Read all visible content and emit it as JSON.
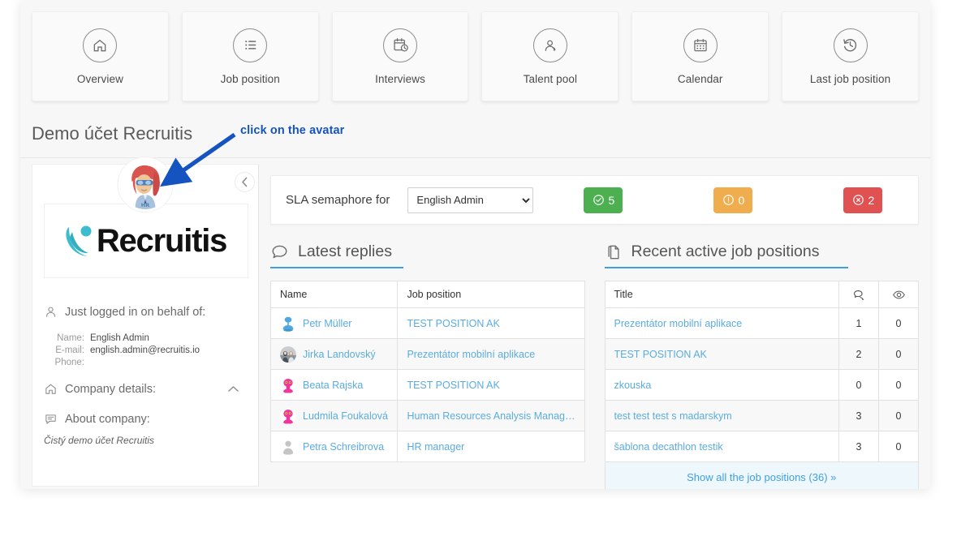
{
  "nav_tiles": [
    {
      "label": "Overview",
      "icon": "home-icon"
    },
    {
      "label": "Job position",
      "icon": "list-icon"
    },
    {
      "label": "Interviews",
      "icon": "calendar-clock-icon"
    },
    {
      "label": "Talent pool",
      "icon": "user-badge-icon"
    },
    {
      "label": "Calendar",
      "icon": "calendar-icon"
    },
    {
      "label": "Last job position",
      "icon": "history-icon"
    }
  ],
  "page_title": "Demo účet Recruitis",
  "annotation": {
    "text": "click on the avatar",
    "color": "#1554c0"
  },
  "sidebar": {
    "collapse_label": "‹",
    "logo_text": "Recruitis",
    "logged_in_heading": "Just logged in on behalf of:",
    "details": [
      {
        "key": "Name:",
        "value": "English Admin"
      },
      {
        "key": "E-mail:",
        "value": "english.admin@recruitis.io"
      },
      {
        "key": "Phone:",
        "value": ""
      }
    ],
    "company_details_label": "Company details:",
    "about_company_label": "About company:",
    "about_company_text": "Čistý demo účet Recruitis"
  },
  "sla": {
    "label": "SLA semaphore for",
    "selected_option": "English Admin",
    "options": [
      "English Admin"
    ],
    "badges": [
      {
        "name": "sla-ok",
        "icon": "check-circle-icon",
        "value": "5",
        "color": "#4caf50"
      },
      {
        "name": "sla-warning",
        "icon": "exclamation-circle-icon",
        "value": "0",
        "color": "#f0ad4e"
      },
      {
        "name": "sla-critical",
        "icon": "times-circle-icon",
        "value": "2",
        "color": "#e05252"
      }
    ]
  },
  "latest_replies": {
    "title": "Latest replies",
    "icon": "comment-icon",
    "columns": [
      "Name",
      "Job position"
    ],
    "rows": [
      {
        "name": "Petr Müller",
        "position": "TEST POSITION AK",
        "avatar": "blue-figure"
      },
      {
        "name": "Jirka Landovský",
        "position": "Prezentátor mobilní aplikace",
        "avatar": "photo"
      },
      {
        "name": "Beata Rajska",
        "position": "TEST POSITION AK",
        "avatar": "pink-monster"
      },
      {
        "name": "Ludmila Foukalová",
        "position": "Human Resources Analysis Manag…",
        "avatar": "pink-monster"
      },
      {
        "name": "Petra Schreibrova",
        "position": "HR manager",
        "avatar": "gray-silhouette"
      }
    ]
  },
  "recent_jobs": {
    "title": "Recent active job positions",
    "icon": "documents-icon",
    "columns": [
      "Title",
      "comments-icon",
      "eye-icon"
    ],
    "rows": [
      {
        "title": "Prezentátor mobilní aplikace",
        "comments": "1",
        "views": "0"
      },
      {
        "title": "TEST POSITION AK",
        "comments": "2",
        "views": "0"
      },
      {
        "title": "zkouska",
        "comments": "0",
        "views": "0"
      },
      {
        "title": "test test test s madarskym",
        "comments": "3",
        "views": "0"
      },
      {
        "title": "šablona decathlon testik",
        "comments": "3",
        "views": "0"
      }
    ],
    "footer_link": "Show all the job positions (36) »"
  }
}
